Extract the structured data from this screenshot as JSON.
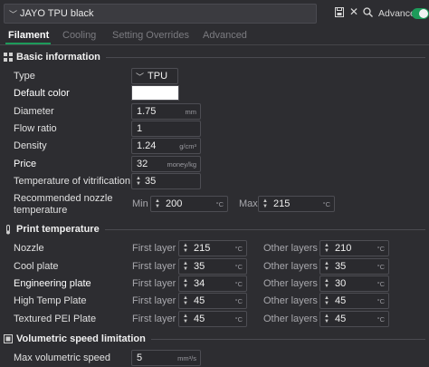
{
  "header": {
    "preset_name": "JAYO TPU black",
    "advanced_label": "Advanced",
    "advanced_enabled": true
  },
  "tabs": [
    {
      "label": "Filament",
      "active": true
    },
    {
      "label": "Cooling",
      "active": false
    },
    {
      "label": "Setting Overrides",
      "active": false
    },
    {
      "label": "Advanced",
      "active": false
    }
  ],
  "basic": {
    "title": "Basic information",
    "type_label": "Type",
    "type_value": "TPU",
    "color_label": "Default color",
    "color_value": "#ffffff",
    "diameter_label": "Diameter",
    "diameter_value": "1.75",
    "diameter_unit": "mm",
    "flow_label": "Flow ratio",
    "flow_value": "1",
    "density_label": "Density",
    "density_value": "1.24",
    "density_unit": "g/cm³",
    "price_label": "Price",
    "price_value": "32",
    "price_unit": "money/kg",
    "vitrification_label": "Temperature of vitrification",
    "vitrification_value": "35",
    "nozzle_rec_label_1": "Recommended nozzle",
    "nozzle_rec_label_2": "temperature",
    "min_label": "Min",
    "min_value": "200",
    "max_label": "Max",
    "max_value": "215",
    "temp_unit": "°C"
  },
  "print_temp": {
    "title": "Print temperature",
    "first_layer_label": "First layer",
    "other_layers_label": "Other layers",
    "unit": "°C",
    "rows": [
      {
        "label": "Nozzle",
        "first": "215",
        "other": "210"
      },
      {
        "label": "Cool plate",
        "first": "35",
        "other": "35"
      },
      {
        "label": "Engineering plate",
        "first": "34",
        "other": "30"
      },
      {
        "label": "High Temp Plate",
        "first": "45",
        "other": "45"
      },
      {
        "label": "Textured PEI Plate",
        "first": "45",
        "other": "45"
      }
    ]
  },
  "volumetric": {
    "title": "Volumetric speed limitation",
    "max_label": "Max volumetric speed",
    "max_value": "5",
    "max_unit": "mm³/s"
  },
  "icons": [
    "chevron-down-icon",
    "save-icon",
    "close-icon",
    "search-icon",
    "grid-icon",
    "thermometer-icon",
    "gauge-icon"
  ],
  "colors": {
    "accent": "#1d9b5a",
    "background": "#2d2d31"
  }
}
